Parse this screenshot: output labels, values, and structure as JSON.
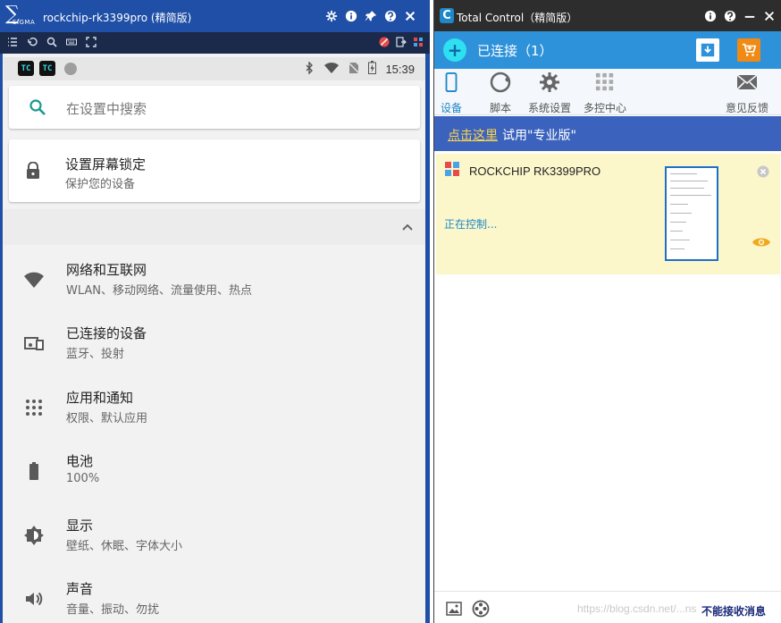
{
  "left_window": {
    "logo_text": "∑",
    "logo_sub": "SIGMA",
    "title": "rockchip-rk3399pro (精简版)",
    "title_icons": [
      "gear-icon",
      "info-icon",
      "pin-icon",
      "help-icon",
      "close-icon"
    ],
    "toolbar_icons": [
      "list-icon",
      "refresh-icon",
      "search-icon",
      "keyboard-icon",
      "fullscreen-icon"
    ],
    "toolbar_right_icons": [
      "disabled-icon",
      "exit-icon",
      "apps-icon"
    ]
  },
  "statusbar": {
    "tc1": "TC",
    "tc2": "TC",
    "time": "15:39"
  },
  "phone": {
    "search_placeholder": "在设置中搜索",
    "lock_title": "设置屏幕锁定",
    "lock_subtitle": "保护您的设备",
    "settings": [
      {
        "title": "网络和互联网",
        "subtitle": "WLAN、移动网络、流量使用、热点",
        "icon": "wifi-icon"
      },
      {
        "title": "已连接的设备",
        "subtitle": "蓝牙、投射",
        "icon": "devices-icon"
      },
      {
        "title": "应用和通知",
        "subtitle": "权限、默认应用",
        "icon": "apps-grid-icon"
      },
      {
        "title": "电池",
        "subtitle": "100%",
        "icon": "battery-icon"
      },
      {
        "title": "显示",
        "subtitle": "壁纸、休眠、字体大小",
        "icon": "brightness-icon"
      },
      {
        "title": "声音",
        "subtitle": "音量、振动、勿扰",
        "icon": "volume-icon"
      }
    ]
  },
  "right_window": {
    "logo_text": "C",
    "title": "Total Control（精简版）",
    "connected_label": "已连接（1）",
    "tabs": [
      {
        "label": "设备",
        "active": true
      },
      {
        "label": "脚本",
        "active": false
      },
      {
        "label": "系统设置",
        "active": false
      },
      {
        "label": "多控中心",
        "active": false
      },
      {
        "label": "意见反馈",
        "active": false
      }
    ],
    "promo_link": "点击这里",
    "promo_text": "试用\"专业版\"",
    "device_name": "ROCKCHIP RK3399PRO",
    "device_state": "正在控制...",
    "footer_message": "不能接收消息",
    "watermark": "https://blog.csdn.net/...ns"
  },
  "colors": {
    "left_title_bg": "#1f4fa6",
    "right_accent": "#2d92d9",
    "promo_bg": "#3b63be",
    "device_card_bg": "#fbf7cb"
  }
}
